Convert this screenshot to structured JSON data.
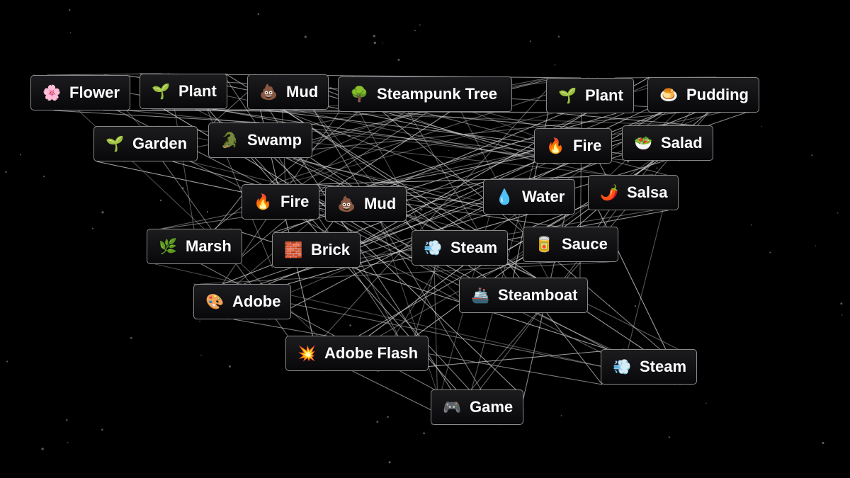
{
  "game": "Infinite Craft",
  "elements": [
    {
      "id": "flower",
      "label": "Flower",
      "emoji": "🌸",
      "icon": "cherry-blossom-icon"
    },
    {
      "id": "plant1",
      "label": "Plant",
      "emoji": "🌱",
      "icon": "seedling-icon"
    },
    {
      "id": "mud1",
      "label": "Mud",
      "emoji": "💩",
      "icon": "pile-of-poo-icon"
    },
    {
      "id": "steampunk-tree",
      "label": "Steampunk Tree",
      "emoji": "🌳",
      "icon": "tree-icon"
    },
    {
      "id": "plant2",
      "label": "Plant",
      "emoji": "🌱",
      "icon": "seedling-icon"
    },
    {
      "id": "pudding",
      "label": "Pudding",
      "emoji": "🍮",
      "icon": "custard-icon"
    },
    {
      "id": "garden",
      "label": "Garden",
      "emoji": "🌱",
      "icon": "seedling-icon"
    },
    {
      "id": "swamp",
      "label": "Swamp",
      "emoji": "🐊",
      "icon": "crocodile-icon"
    },
    {
      "id": "fire1",
      "label": "Fire",
      "emoji": "🔥",
      "icon": "fire-icon"
    },
    {
      "id": "salad",
      "label": "Salad",
      "emoji": "🥗",
      "icon": "salad-icon"
    },
    {
      "id": "fire2",
      "label": "Fire",
      "emoji": "🔥",
      "icon": "fire-icon"
    },
    {
      "id": "mud2",
      "label": "Mud",
      "emoji": "💩",
      "icon": "pile-of-poo-icon"
    },
    {
      "id": "water",
      "label": "Water",
      "emoji": "💧",
      "icon": "droplet-icon"
    },
    {
      "id": "salsa",
      "label": "Salsa",
      "emoji": "🌶️",
      "icon": "hot-pepper-icon"
    },
    {
      "id": "marsh",
      "label": "Marsh",
      "emoji": "🌿",
      "icon": "herb-icon"
    },
    {
      "id": "brick",
      "label": "Brick",
      "emoji": "🧱",
      "icon": "brick-icon"
    },
    {
      "id": "steam1",
      "label": "Steam",
      "emoji": "💨",
      "icon": "dash-icon"
    },
    {
      "id": "sauce",
      "label": "Sauce",
      "emoji": "🥫",
      "icon": "sauce-icon"
    },
    {
      "id": "adobe",
      "label": "Adobe",
      "emoji": "🎨",
      "icon": "palette-icon"
    },
    {
      "id": "steamboat",
      "label": "Steamboat",
      "emoji": "🚢",
      "icon": "ship-icon"
    },
    {
      "id": "adobe-flash",
      "label": "Adobe Flash",
      "emoji": "💥",
      "icon": "collision-icon"
    },
    {
      "id": "steam2",
      "label": "Steam",
      "emoji": "💨",
      "icon": "dash-icon"
    },
    {
      "id": "game",
      "label": "Game",
      "emoji": "🎮",
      "icon": "game-controller-icon"
    }
  ]
}
